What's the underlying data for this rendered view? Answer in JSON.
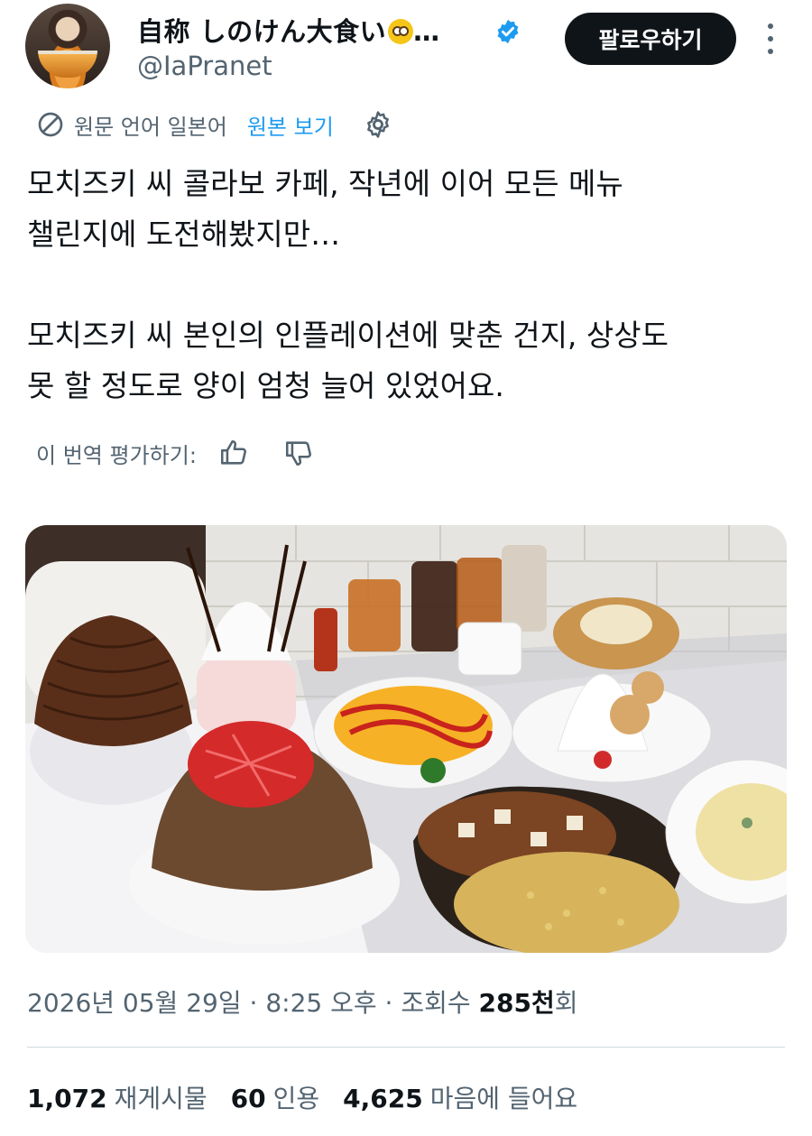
{
  "author": {
    "display_name": "自称 しのけん大食い",
    "ellipsis": "…",
    "handle": "@IaPranet",
    "avatar_icon": "avatar-photo",
    "verified_icon": "verified-badge-icon",
    "emoji_icon": "face-with-rolling-eyes-emoji"
  },
  "follow_label": "팔로우하기",
  "translation": {
    "note": "원문 언어 일본어",
    "show_original": "원본 보기"
  },
  "tweet_text": "모치즈키 씨 콜라보 카페, 작년에 이어 모든 메뉴\n챌린지에 도전해봤지만…\n\n모치즈키 씨 본인의 인플레이션에 맞춘 건지, 상상도\n못 할 정도로 양이 엄청 늘어 있었어요.",
  "rate_translation": "이 번역 평가하기:",
  "meta": {
    "date": "2026년 05월 29일",
    "time": "8:25 오후",
    "views_label": "조회수",
    "views_value": "285천",
    "views_suffix": "회"
  },
  "stats": [
    {
      "value": "1,072",
      "label": "재게시물"
    },
    {
      "value": "60",
      "label": "인용"
    },
    {
      "value": "4,625",
      "label": "마음에 들어요"
    }
  ],
  "colors": {
    "accent": "#1d9bf0",
    "text": "#0f1419",
    "muted": "#536471",
    "button_bg": "#0f1419"
  }
}
